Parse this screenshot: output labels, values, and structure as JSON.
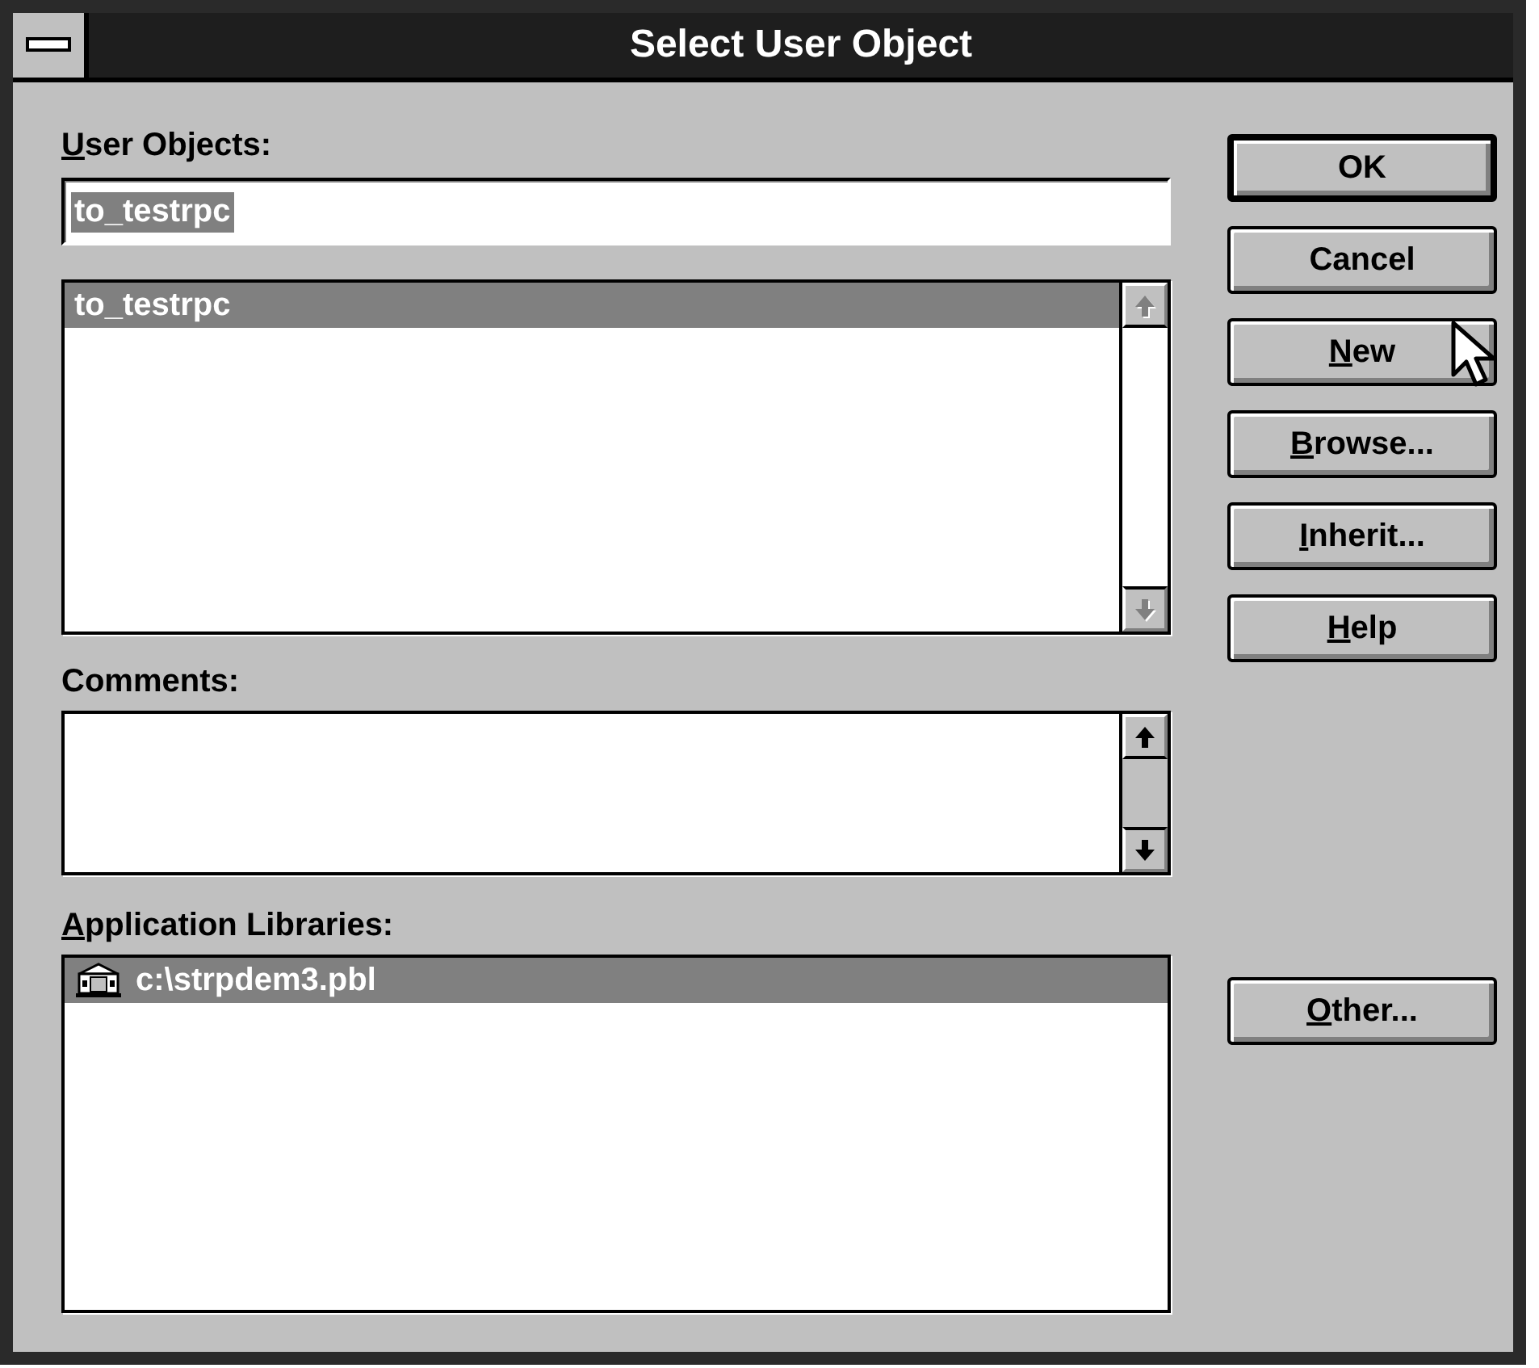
{
  "window": {
    "title": "Select User Object"
  },
  "user_objects": {
    "label": {
      "accel": "U",
      "rest": "ser Objects:"
    },
    "field": {
      "value": "to_testrpc",
      "selected": true
    },
    "list": {
      "items": [
        {
          "text": "to_testrpc",
          "selected": true
        }
      ],
      "scrollbar": {
        "disabled": true
      }
    }
  },
  "comments": {
    "label": {
      "rest": "Comments:"
    },
    "scrollbar": {
      "disabled": false
    }
  },
  "application_libraries": {
    "label": {
      "accel": "A",
      "rest": "pplication Libraries:"
    },
    "items": [
      {
        "text": "c:\\strpdem3.pbl",
        "kind": "library",
        "selected": true
      }
    ]
  },
  "buttons": [
    {
      "rest": "OK",
      "default": true
    },
    {
      "rest": "Cancel",
      "default": false
    },
    {
      "accel": "N",
      "rest": "ew",
      "default": false
    },
    {
      "accel": "B",
      "rest": "rowse...",
      "default": false
    },
    {
      "accel": "I",
      "rest": "nherit...",
      "default": false
    },
    {
      "accel": "H",
      "rest": "elp",
      "default": false
    }
  ],
  "other_button": {
    "accel": "O",
    "rest": "ther...",
    "default": false
  }
}
